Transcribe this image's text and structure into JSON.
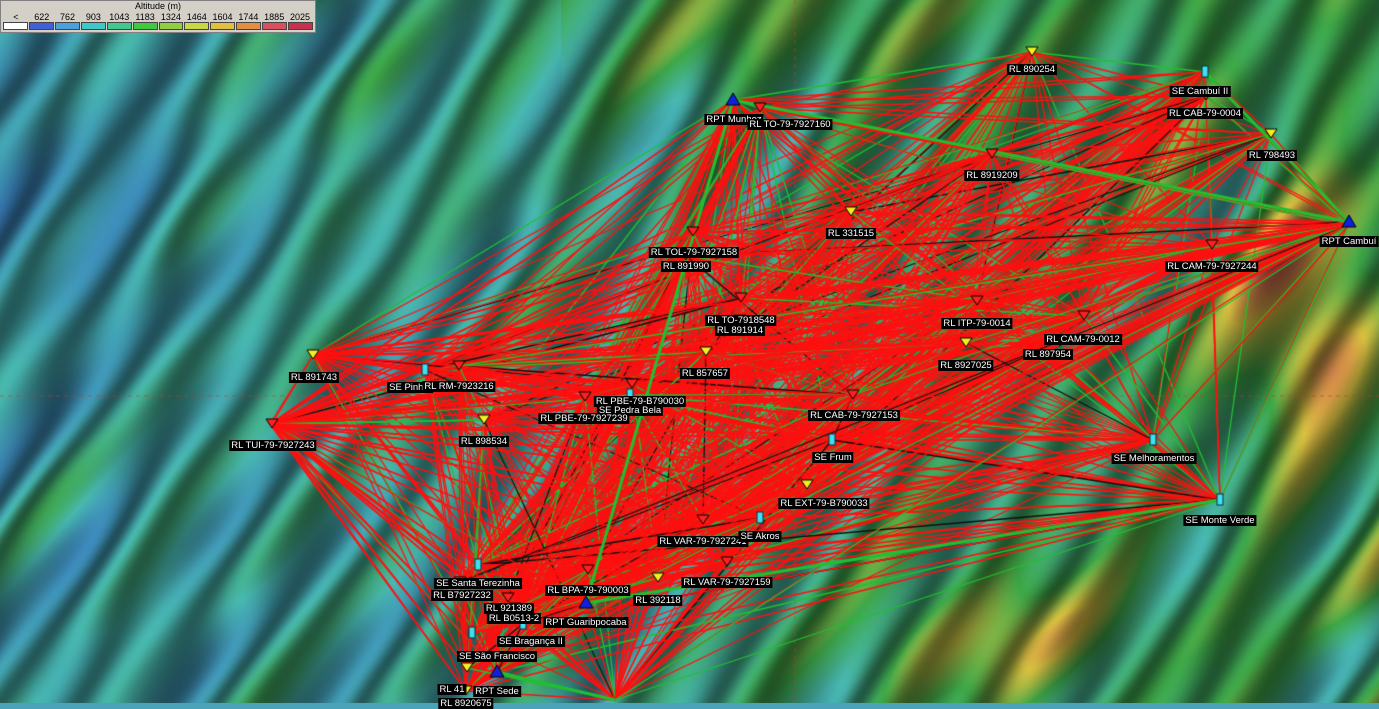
{
  "legend": {
    "title": "Altitude (m)",
    "ticks": [
      "<",
      "622",
      "762",
      "903",
      "1043",
      "1183",
      "1324",
      "1464",
      "1604",
      "1744",
      "1885",
      "2025"
    ],
    "colors": [
      "#ffffff",
      "#4060d8",
      "#4aa0d8",
      "#40c8c8",
      "#40c890",
      "#40c840",
      "#90d040",
      "#c8d840",
      "#e0c040",
      "#e09040",
      "#d85060",
      "#c83050"
    ]
  },
  "map": {
    "terrain_colors": {
      "low": "#3a7fc0",
      "mid": "#48b8b0",
      "green": "#3ea848",
      "high": "#d8c040",
      "peak": "#d04058"
    },
    "link_colors": {
      "blocked": "#ff1010",
      "clear": "#20c030",
      "marginal": "#101010"
    },
    "sites": [
      {
        "label": "RL 890254",
        "type": "relay-yellow"
      },
      {
        "label": "SE Cambuí II",
        "type": "substation"
      },
      {
        "label": "RL CAB-79-0004",
        "type": "relay-red"
      },
      {
        "label": "RL 798493",
        "type": "relay-yellow"
      },
      {
        "label": "RPT Munhoz",
        "type": "repeater"
      },
      {
        "label": "RL TO-79-7927160",
        "type": "relay-red"
      },
      {
        "label": "RL 8919209",
        "type": "relay-red"
      },
      {
        "label": "RPT Cambuí",
        "type": "repeater"
      },
      {
        "label": "RL 331515",
        "type": "relay-yellow"
      },
      {
        "label": "RL TOL-79-7927158",
        "type": "relay-red"
      },
      {
        "label": "RL 891990",
        "type": "relay-red"
      },
      {
        "label": "RL CAM-79-7927244",
        "type": "relay-red"
      },
      {
        "label": "RL TO-7918548",
        "type": "relay-red"
      },
      {
        "label": "RL 891914",
        "type": "relay-yellow"
      },
      {
        "label": "RL ITP-79-0014",
        "type": "relay-red"
      },
      {
        "label": "RL CAM-79-0012",
        "type": "relay-red"
      },
      {
        "label": "RL 897954",
        "type": "relay-red"
      },
      {
        "label": "RL 8927025",
        "type": "relay-yellow"
      },
      {
        "label": "RL 891743",
        "type": "relay-yellow"
      },
      {
        "label": "SE Pinhal",
        "type": "substation"
      },
      {
        "label": "RL RM-7923216",
        "type": "relay-red"
      },
      {
        "label": "RL 857657",
        "type": "relay-yellow"
      },
      {
        "label": "RL PBE-79-B790030",
        "type": "relay-red"
      },
      {
        "label": "SE Pedra Bela",
        "type": "substation"
      },
      {
        "label": "RL PBE-79-7927239",
        "type": "relay-red"
      },
      {
        "label": "RL CAB-79-7927153",
        "type": "relay-red"
      },
      {
        "label": "RL TUI-79-7927243",
        "type": "relay-red"
      },
      {
        "label": "RL 898534",
        "type": "relay-yellow"
      },
      {
        "label": "SE Frum",
        "type": "substation"
      },
      {
        "label": "SE Melhoramentos",
        "type": "substation"
      },
      {
        "label": "RL EXT-79-B790033",
        "type": "relay-yellow"
      },
      {
        "label": "SE Monte Verde",
        "type": "substation"
      },
      {
        "label": "RL VAR-79-7927241",
        "type": "relay-red"
      },
      {
        "label": "SE Akros",
        "type": "substation"
      },
      {
        "label": "SE Santa Terezinha",
        "type": "substation"
      },
      {
        "label": "RL B7927232",
        "type": "relay-red"
      },
      {
        "label": "RL 921389",
        "type": "relay-red"
      },
      {
        "label": "RL B0513-2",
        "type": "relay-red"
      },
      {
        "label": "RL BPA-79-790003",
        "type": "relay-red"
      },
      {
        "label": "RL 392118",
        "type": "relay-yellow"
      },
      {
        "label": "RL VAR-79-7927159",
        "type": "relay-red"
      },
      {
        "label": "RPT Guaribpocaba",
        "type": "repeater"
      },
      {
        "label": "SE Bragança II",
        "type": "substation"
      },
      {
        "label": "SE São Francisco",
        "type": "substation"
      },
      {
        "label": "RL 41",
        "type": "relay-yellow"
      },
      {
        "label": "RPT Sede",
        "type": "repeater"
      },
      {
        "label": "RL 8920675",
        "type": "relay-yellow"
      }
    ]
  }
}
